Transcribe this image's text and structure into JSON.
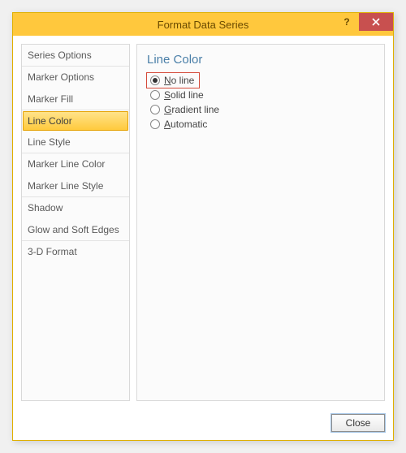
{
  "title": "Format Data Series",
  "help_glyph": "?",
  "sidebar": {
    "items": [
      {
        "label": "Series Options"
      },
      {
        "label": "Marker Options"
      },
      {
        "label": "Marker Fill"
      },
      {
        "label": "Line Color"
      },
      {
        "label": "Line Style"
      },
      {
        "label": "Marker Line Color"
      },
      {
        "label": "Marker Line Style"
      },
      {
        "label": "Shadow"
      },
      {
        "label": "Glow and Soft Edges"
      },
      {
        "label": "3-D Format"
      }
    ],
    "selected_index": 3
  },
  "pane": {
    "heading": "Line Color",
    "options": [
      {
        "prefix": "N",
        "rest": "o line",
        "checked": true,
        "highlight": true
      },
      {
        "prefix": "S",
        "rest": "olid line",
        "checked": false,
        "highlight": false
      },
      {
        "prefix": "G",
        "rest": "radient line",
        "checked": false,
        "highlight": false
      },
      {
        "prefix": "A",
        "rest": "utomatic",
        "checked": false,
        "highlight": false
      }
    ]
  },
  "footer": {
    "close_label": "Close"
  }
}
